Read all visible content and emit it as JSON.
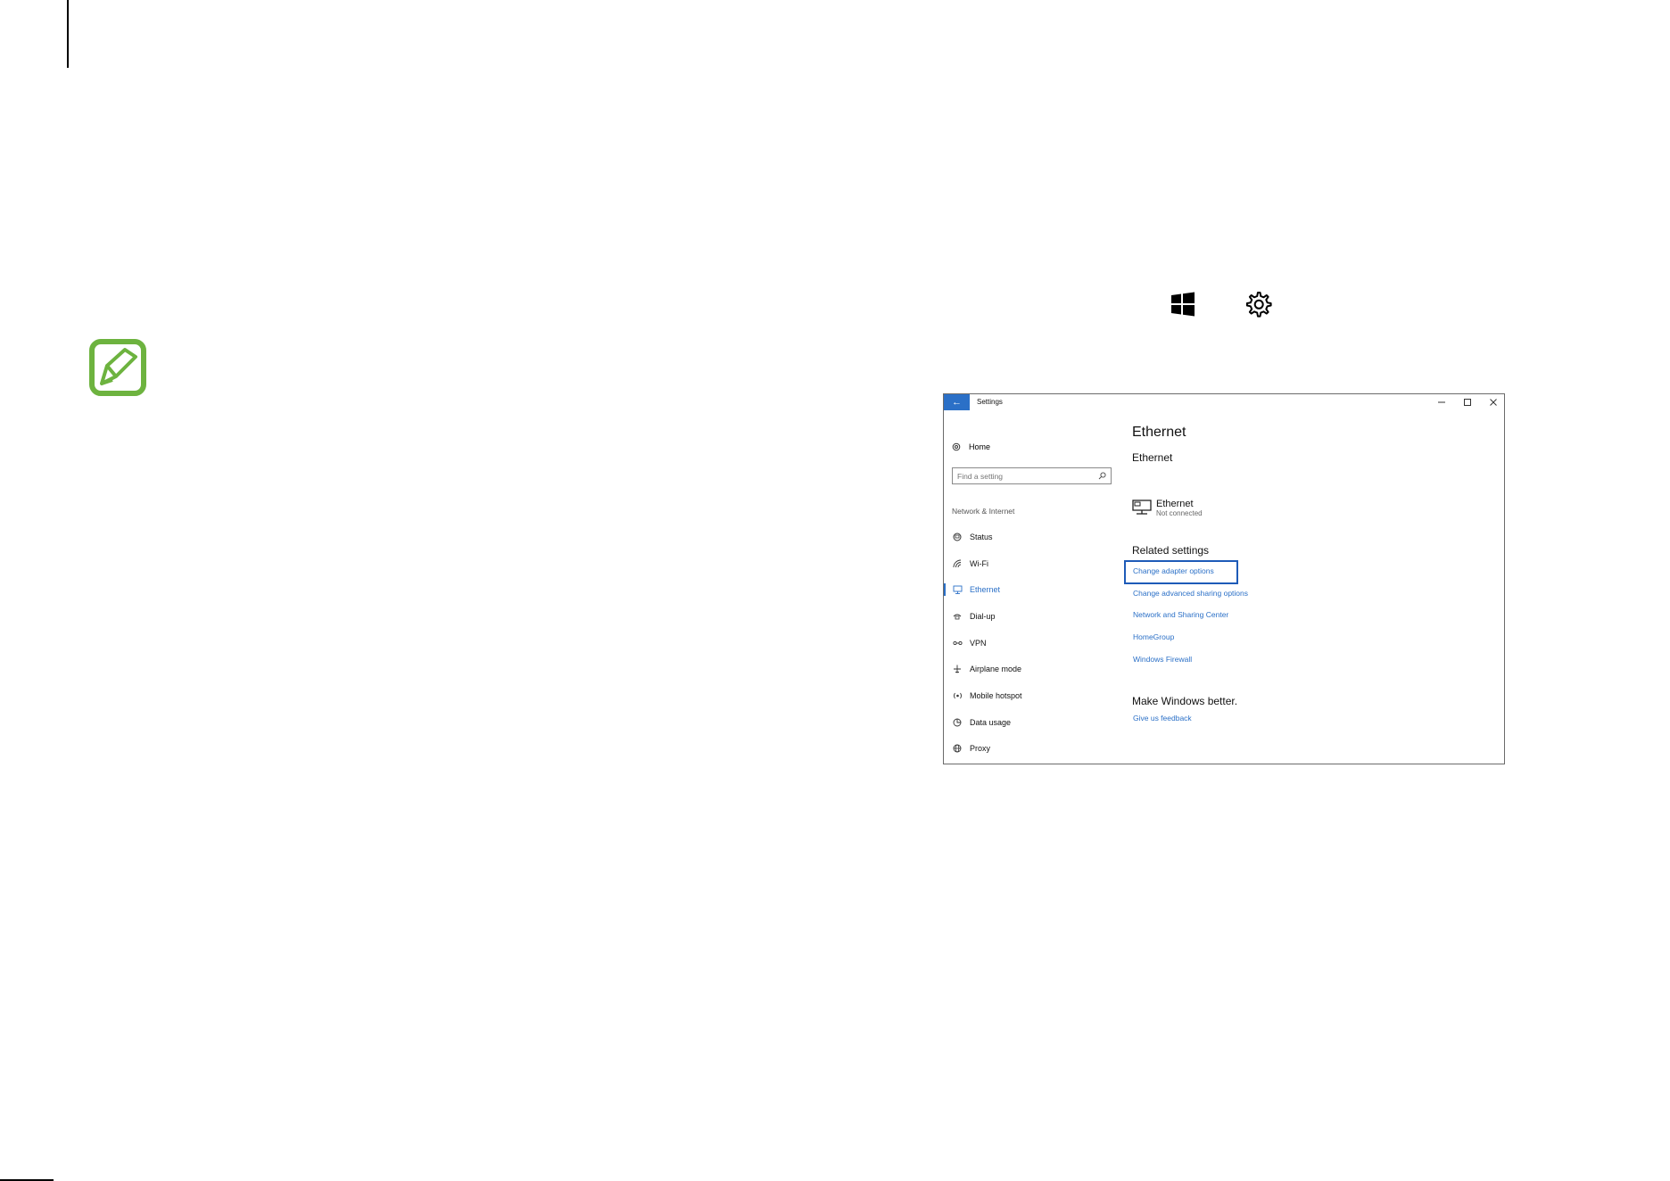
{
  "window": {
    "title": "Settings",
    "back_label": "←",
    "controls": {
      "minimize": "–",
      "maximize": "□",
      "close": "×"
    }
  },
  "sidebar": {
    "home_label": "Home",
    "search_placeholder": "Find a setting",
    "section_label": "Network & Internet",
    "items": [
      {
        "label": "Status",
        "icon": "status-icon"
      },
      {
        "label": "Wi-Fi",
        "icon": "wifi-icon"
      },
      {
        "label": "Ethernet",
        "icon": "ethernet-icon",
        "active": true
      },
      {
        "label": "Dial-up",
        "icon": "dialup-icon"
      },
      {
        "label": "VPN",
        "icon": "vpn-icon"
      },
      {
        "label": "Airplane mode",
        "icon": "airplane-icon"
      },
      {
        "label": "Mobile hotspot",
        "icon": "hotspot-icon"
      },
      {
        "label": "Data usage",
        "icon": "data-usage-icon"
      },
      {
        "label": "Proxy",
        "icon": "globe-icon"
      }
    ]
  },
  "main": {
    "page_title": "Ethernet",
    "subheading": "Ethernet",
    "connection": {
      "name": "Ethernet",
      "status": "Not connected"
    },
    "related_heading": "Related settings",
    "related_links": [
      "Change adapter options",
      "Change advanced sharing options",
      "Network and Sharing Center",
      "HomeGroup",
      "Windows Firewall"
    ],
    "better_heading": "Make Windows better.",
    "feedback_link": "Give us feedback"
  },
  "colors": {
    "accent": "#2b70c7",
    "note_icon": "#6db33f",
    "highlight_border": "#1e5bb8"
  }
}
